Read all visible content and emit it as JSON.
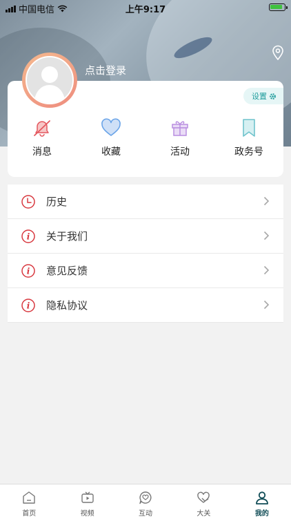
{
  "status_bar": {
    "carrier": "中国电信",
    "time": "上午9:17",
    "battery_color": "#3fc23f"
  },
  "profile": {
    "login_text": "点击登录",
    "settings_label": "设置"
  },
  "quick_actions": [
    {
      "label": "消息",
      "icon": "bell-off-icon",
      "color": "#e4575e"
    },
    {
      "label": "收藏",
      "icon": "heart-icon",
      "color": "#6aa4e8"
    },
    {
      "label": "活动",
      "icon": "gift-icon",
      "color": "#b98ee0"
    },
    {
      "label": "政务号",
      "icon": "bookmark-icon",
      "color": "#6fc3cc"
    }
  ],
  "menu": [
    {
      "label": "历史",
      "icon": "clock-icon"
    },
    {
      "label": "关于我们",
      "icon": "info-icon"
    },
    {
      "label": "意见反馈",
      "icon": "info-icon"
    },
    {
      "label": "隐私协议",
      "icon": "info-icon"
    }
  ],
  "accent_red": "#d8383f",
  "tabs": [
    {
      "label": "首页",
      "icon": "home-icon"
    },
    {
      "label": "视频",
      "icon": "tv-icon"
    },
    {
      "label": "互动",
      "icon": "chat-heart-icon"
    },
    {
      "label": "大关",
      "icon": "heart-hand-icon"
    },
    {
      "label": "我的",
      "icon": "user-icon",
      "active": true
    }
  ]
}
